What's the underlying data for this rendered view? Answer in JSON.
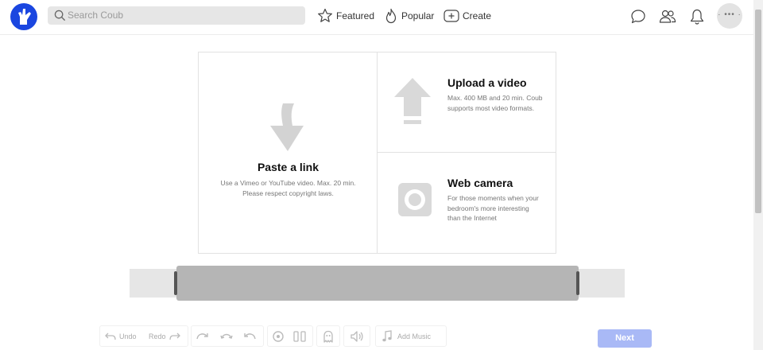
{
  "header": {
    "search_placeholder": "Search Coub",
    "nav": {
      "featured": "Featured",
      "popular": "Popular",
      "create": "Create"
    },
    "avatar_text": "· ••• ·"
  },
  "upload_panel": {
    "link": {
      "title": "Paste a link",
      "description": "Use a Vimeo or YouTube video. Max. 20 min. Please respect copyright laws."
    },
    "upload": {
      "title": "Upload a video",
      "description": "Max. 400 MB and 20 min. Coub supports most video formats."
    },
    "camera": {
      "title": "Web camera",
      "description": "For those moments when your bedroom's more interesting than the Internet"
    }
  },
  "toolbar": {
    "undo": "Undo",
    "redo": "Redo",
    "add_music": "Add Music",
    "next": "Next"
  },
  "colors": {
    "brand": "#1a46e0",
    "next_disabled": "#a9b9f6",
    "timeline_selection": "#b5b5b5"
  }
}
